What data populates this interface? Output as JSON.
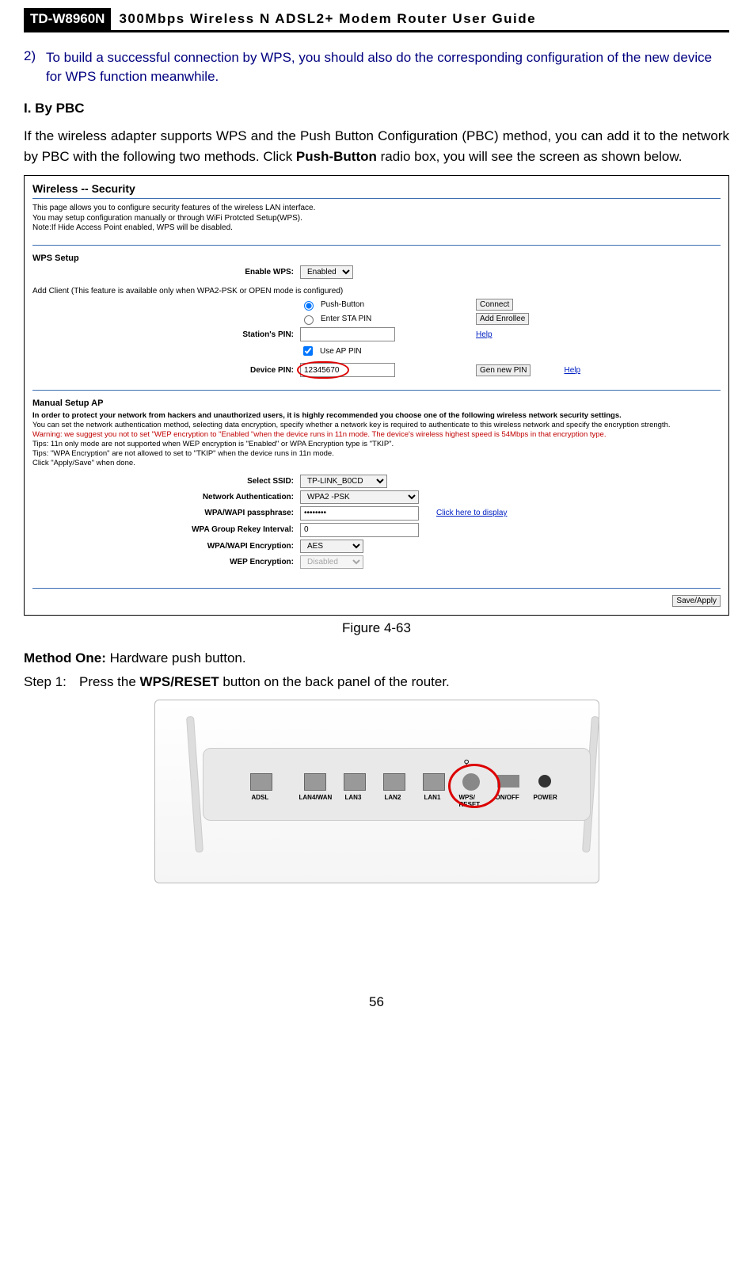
{
  "header": {
    "model": "TD-W8960N",
    "title": "300Mbps Wireless N ADSL2+ Modem Router User Guide"
  },
  "item2": {
    "num": "2)",
    "text": "To build a successful connection by WPS, you should also do the corresponding configuration of the new device for WPS function meanwhile."
  },
  "sectionI": "I.  By PBC",
  "pbc_intro_1": "If the wireless adapter supports WPS and the Push Button Configuration (PBC) method, you can add it to the network by PBC with the following two methods. Click ",
  "pbc_intro_bold": "Push-Button",
  "pbc_intro_2": " radio box, you will see the screen as shown below.",
  "screenshot": {
    "title": "Wireless -- Security",
    "intro1": "This page allows you to configure security features of the wireless LAN interface.",
    "intro2": "You may setup configuration manually or through WiFi Protcted Setup(WPS).",
    "intro3": "Note:If Hide Access Point enabled, WPS will be disabled.",
    "wps_setup": "WPS Setup",
    "enable_wps_label": "Enable WPS:",
    "enable_wps_value": "Enabled",
    "add_client": "Add Client (This feature is available only when WPA2-PSK or OPEN mode is configured)",
    "push_button": "Push-Button",
    "enter_sta_pin": "Enter STA PIN",
    "connect_btn": "Connect",
    "add_enrollee_btn": "Add Enrollee",
    "stations_pin": "Station's PIN:",
    "help_link": "Help",
    "use_ap_pin": "Use AP PIN",
    "device_pin_label": "Device PIN:",
    "device_pin_value": "12345670",
    "gen_new_pin": "Gen new PIN",
    "manual_setup": "Manual Setup AP",
    "tips": {
      "l1": "In order to protect your network from hackers and unauthorized users, it is highly recommended you choose one of the following wireless network security settings.",
      "l2": "You can set the network authentication method, selecting data encryption, specify whether a network key is required to authenticate to this wireless network and specify the encryption strength.",
      "l3": "Warning: we suggest you not to set \"WEP encryption to \"Enabled \"when the device runs in 11n mode. The device's wireless highest speed is 54Mbps in that encryption type.",
      "l4": "Tips: 11n only mode are not supported when WEP encryption is \"Enabled\" or WPA Encryption type is \"TKIP\".",
      "l5": "Tips: \"WPA Encryption\" are not allowed to set to \"TKIP\" when the device runs in 11n mode.",
      "l6": "Click \"Apply/Save\" when done."
    },
    "select_ssid_label": "Select SSID:",
    "select_ssid_value": "TP-LINK_B0CD",
    "net_auth_label": "Network Authentication:",
    "net_auth_value": "WPA2 -PSK",
    "passphrase_label": "WPA/WAPI passphrase:",
    "passphrase_value": "••••••••",
    "click_display": "Click here to display",
    "rekey_label": "WPA Group Rekey Interval:",
    "rekey_value": "0",
    "wpa_enc_label": "WPA/WAPI Encryption:",
    "wpa_enc_value": "AES",
    "wep_enc_label": "WEP Encryption:",
    "wep_enc_value": "Disabled",
    "save_apply": "Save/Apply"
  },
  "figure_caption": "Figure 4-63",
  "method_one_bold": "Method One:",
  "method_one_rest": " Hardware push button.",
  "step1_label": "Step 1:",
  "step1_a": "Press the ",
  "step1_bold": "WPS/RESET",
  "step1_b": " button on the back panel of the router.",
  "router": {
    "adsl": "ADSL",
    "lan4": "LAN4/WAN",
    "lan3": "LAN3",
    "lan2": "LAN2",
    "lan1": "LAN1",
    "wps": "WPS/\nRESET",
    "onoff": "ON/OFF",
    "power": "POWER"
  },
  "page_number": "56"
}
